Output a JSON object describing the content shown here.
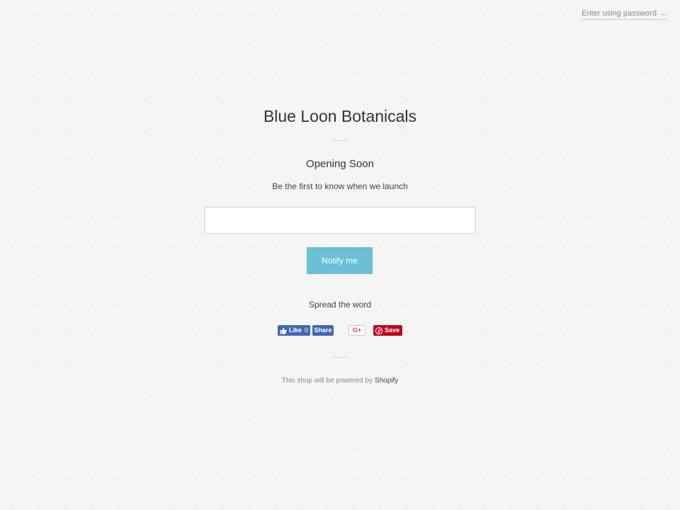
{
  "header": {
    "password_link": "Enter using password →"
  },
  "shop": {
    "title": "Blue Loon Botanicals"
  },
  "signup": {
    "heading": "Opening Soon",
    "subtext": "Be the first to know when we launch",
    "email_value": "",
    "button_label": "Notify me"
  },
  "share": {
    "heading": "Spread the word",
    "fb_like_label": "Like",
    "fb_like_count": "0",
    "fb_share_label": "Share",
    "gplus_label": "G+",
    "pinterest_label": "Save"
  },
  "footer": {
    "text": "This shop will be powered by",
    "link_label": "Shopify"
  },
  "colors": {
    "background": "#f5f5f5",
    "accent_button": "#6cbfd4",
    "facebook": "#4267b2",
    "pinterest": "#bd081c",
    "google_plus": "#d14836"
  }
}
